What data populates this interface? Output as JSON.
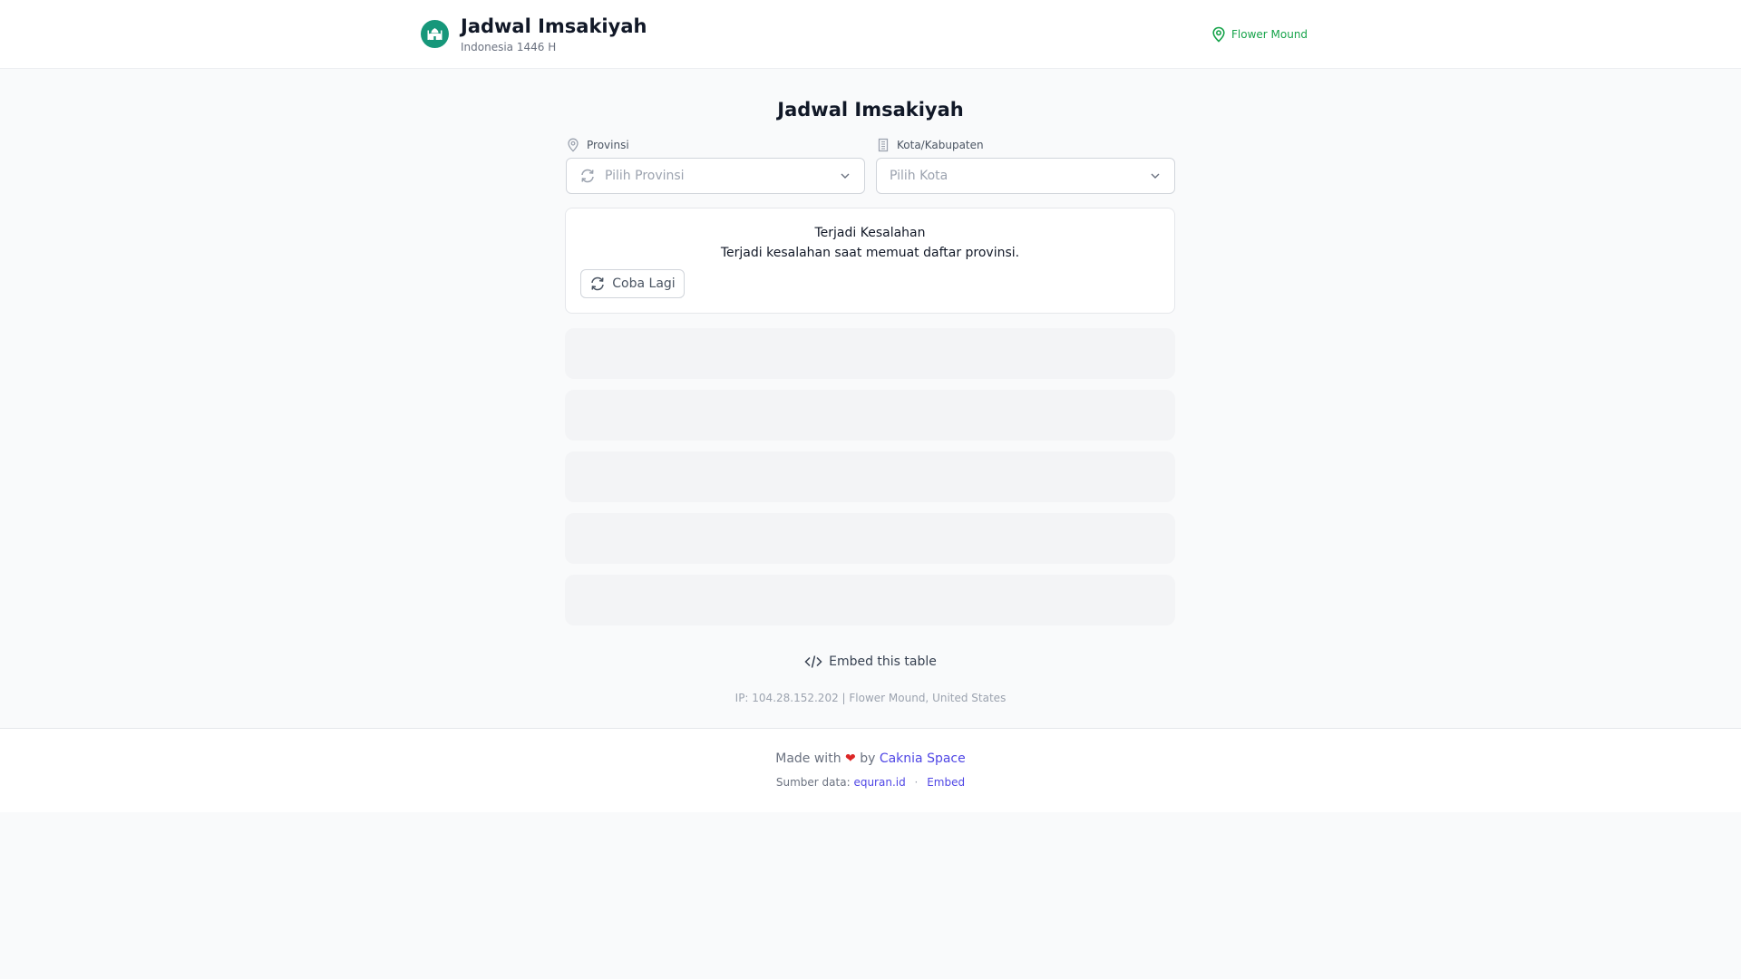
{
  "header": {
    "title": "Jadwal Imsakiyah",
    "subtitle": "Indonesia 1446 H",
    "location": "Flower Mound",
    "accent_color": "#16977a",
    "logo_icon": "mosque-icon"
  },
  "main": {
    "heading": "Jadwal Imsakiyah",
    "province": {
      "label": "Provinsi",
      "placeholder": "Pilih Provinsi"
    },
    "city": {
      "label": "Kota/Kabupaten",
      "placeholder": "Pilih Kota"
    },
    "error": {
      "title": "Terjadi Kesalahan",
      "message": "Terjadi kesalahan saat memuat daftar provinsi.",
      "retry_label": "Coba Lagi"
    },
    "embed_label": "Embed this table",
    "ip_info": "IP: 104.28.152.202 | Flower Mound, United States"
  },
  "footer": {
    "made_with": "Made with",
    "heart": "❤",
    "by": "by",
    "author": "Caknia Space",
    "source_prefix": "Sumber data:",
    "source_link": "equran.id",
    "separator": "·",
    "embed_link": "Embed"
  }
}
